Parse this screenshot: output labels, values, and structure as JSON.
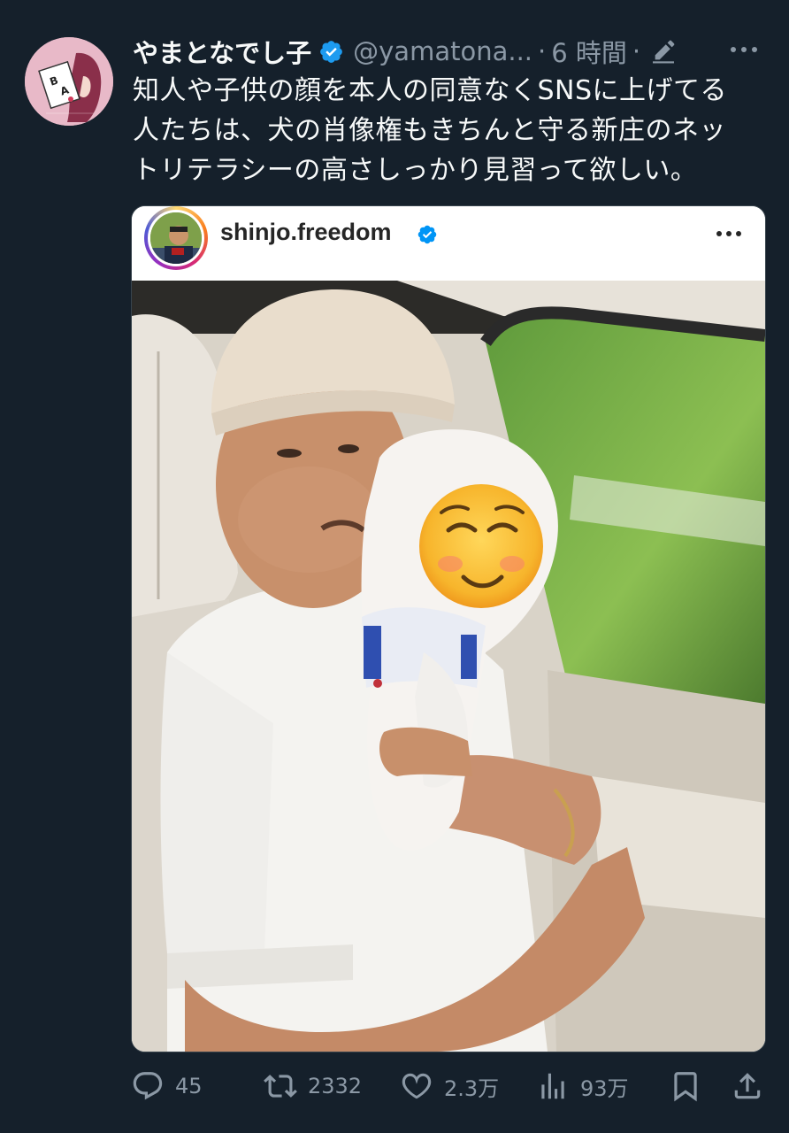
{
  "tweet": {
    "display_name": "やまとなでし子",
    "handle": "@yamatona...",
    "separator": "·",
    "time": "6 時間",
    "body_lines": [
      "知人や子供の顔を本人の同意なくSNSに上げてる",
      "人たちは、犬の肖像権もきちんと守る新庄のネッ",
      "トリテラシーの高さしっかり見習って欲しい。"
    ]
  },
  "embed": {
    "username": "shinjo.freedom"
  },
  "actions": {
    "replies": "45",
    "retweets": "2332",
    "likes": "2.3万",
    "views": "93万"
  },
  "colors": {
    "background": "#15202b",
    "text_primary": "#f7f9f9",
    "text_secondary": "#8b98a5",
    "verified_blue": "#1d9bf0"
  },
  "icons": [
    "verified-badge-icon",
    "edit-icon",
    "more-icon",
    "reply-icon",
    "retweet-icon",
    "like-icon",
    "views-icon",
    "bookmark-icon",
    "share-icon"
  ]
}
